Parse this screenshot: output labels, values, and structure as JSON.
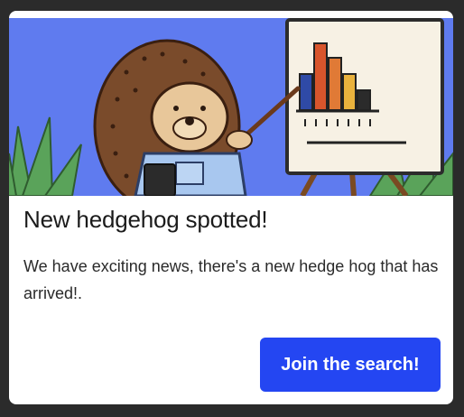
{
  "card": {
    "title": "New hedgehog spotted!",
    "body": "We have exciting news, there's a new hedge hog that has arrived!.",
    "button_label": "Join the search!"
  },
  "hero": {
    "description_icon": "hedgehog-presenting-chart-illustration",
    "background_color": "#5f7bef"
  },
  "colors": {
    "button": "#2446f2",
    "card_bg": "#ffffff",
    "page_bg": "#2b2b2b"
  }
}
